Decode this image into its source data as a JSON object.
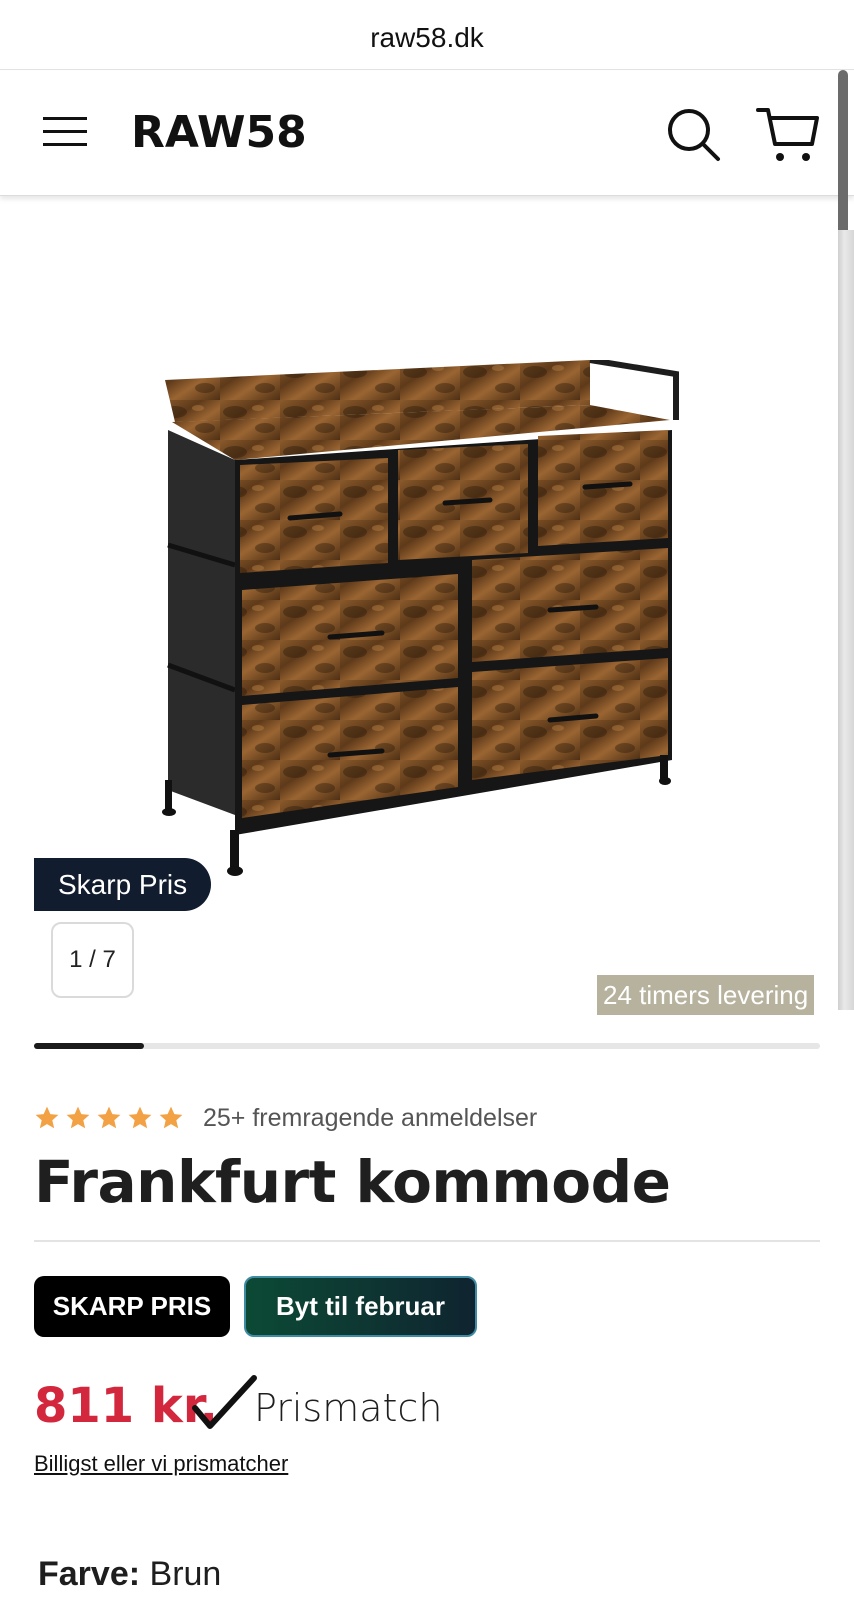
{
  "browser": {
    "url": "raw58.dk"
  },
  "header": {
    "logo": "RAW58",
    "menu_icon": "hamburger-menu-icon",
    "search_icon": "search-icon",
    "cart_icon": "cart-icon"
  },
  "gallery": {
    "badge": "Skarp Pris",
    "pager": "1 / 7",
    "delivery_badge": "24 timers levering",
    "progress_fraction": 0.14
  },
  "product": {
    "rating_stars": 5,
    "rating_text": "25+ fremragende anmeldelser",
    "title": "Frankfurt kommode",
    "tag_primary": "SKARP PRIS",
    "tag_secondary": "Byt til februar",
    "price": "811 kr.",
    "prismatch_label": "Prismatch",
    "prismatch_link": "Billigst eller vi prismatcher",
    "color_label": "Farve:",
    "color_value": "Brun"
  },
  "colors": {
    "price": "#d3273e",
    "star": "#f2a144",
    "badge_dark": "#111c2e",
    "delivery_badge": "#b7b29d"
  }
}
